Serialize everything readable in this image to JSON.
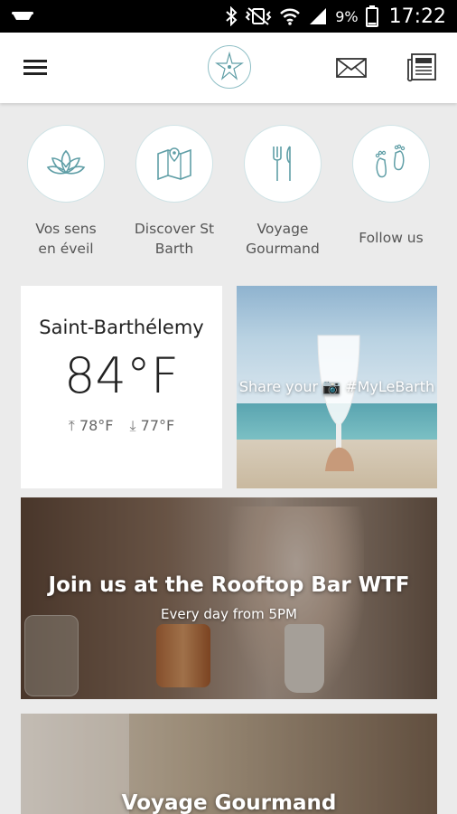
{
  "status_bar": {
    "battery_percent": "9%",
    "time": "17:22",
    "icons": [
      "notification-icon",
      "bluetooth-icon",
      "vibrate-icon",
      "wifi-icon",
      "signal-icon",
      "battery-icon"
    ]
  },
  "app_bar": {
    "icons": [
      "menu-icon",
      "starfish-logo-icon",
      "mail-icon",
      "newspaper-icon"
    ],
    "accent": "#5f9ea6"
  },
  "categories": [
    {
      "label": "Vos sens\nen éveil",
      "icon": "lotus-icon"
    },
    {
      "label": "Discover St\nBarth",
      "icon": "map-icon"
    },
    {
      "label": "Voyage\nGourmand",
      "icon": "fork-knife-icon"
    },
    {
      "label": "Follow us",
      "icon": "footprints-icon"
    }
  ],
  "weather": {
    "location": "Saint-Barthélemy",
    "temperature": "84°F",
    "high": "78°F",
    "low": "77°F"
  },
  "share_card": {
    "text": "Share your 📷 #MyLeBarth"
  },
  "rooftop_banner": {
    "title": "Join us at the Rooftop Bar WTF",
    "subtitle": "Every day from 5PM"
  },
  "gourmand_banner": {
    "title": "Voyage Gourmand"
  }
}
